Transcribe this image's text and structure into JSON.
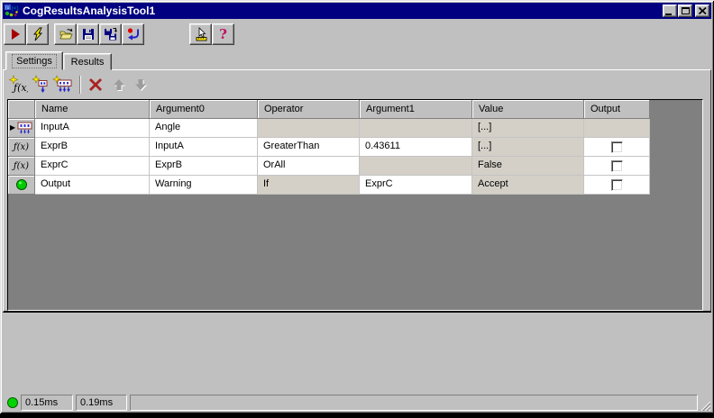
{
  "window": {
    "title": "CogResultsAnalysisTool1"
  },
  "colors": {
    "titlebar": "#000080",
    "window_face": "#c0c0c0",
    "grid_background": "#808080",
    "readonly_cell": "#d4d0c8",
    "led_green": "#00d400",
    "run_red": "#a40000"
  },
  "icons": {
    "titlebar_icon": "app-icon",
    "toolbar": [
      "run-icon",
      "lightning-icon",
      "open-folder-icon",
      "save-icon",
      "save-as-icon",
      "reset-icon",
      "pointer-ruler-icon",
      "help-icon"
    ],
    "grid_toolbar": [
      "add-expression-icon",
      "add-input-icon",
      "add-inputs-icon",
      "delete-icon",
      "move-up-icon",
      "move-down-icon"
    ],
    "caption_buttons": [
      "minimize-icon",
      "maximize-icon",
      "close-icon"
    ]
  },
  "glyphs": {
    "fx": "ƒ(x)",
    "help": "?",
    "current_row": "▶"
  },
  "tabs": {
    "items": [
      {
        "label": "Settings",
        "active": true
      },
      {
        "label": "Results",
        "active": false
      }
    ]
  },
  "grid": {
    "columns": [
      "",
      "Name",
      "Argument0",
      "Operator",
      "Argument1",
      "Value",
      "Output"
    ],
    "rows": [
      {
        "icon": "input-terminal-icon",
        "current": true,
        "name": "InputA",
        "argument0": "Angle",
        "operator": "",
        "argument1": "",
        "value": "[...]",
        "has_checkbox": false,
        "checked": false
      },
      {
        "icon": "function-icon",
        "current": false,
        "name": "ExprB",
        "argument0": "InputA",
        "operator": "GreaterThan",
        "argument1": "0.43611",
        "value": "[...]",
        "has_checkbox": true,
        "checked": false
      },
      {
        "icon": "function-icon",
        "current": false,
        "name": "ExprC",
        "argument0": "ExprB",
        "operator": "OrAll",
        "argument1": "",
        "value": "False",
        "has_checkbox": true,
        "checked": false
      },
      {
        "icon": "output-led-icon",
        "current": false,
        "name": "Output",
        "argument0": "Warning",
        "operator": "If",
        "argument1": "ExprC",
        "value": "Accept",
        "has_checkbox": true,
        "checked": false
      }
    ]
  },
  "statusbar": {
    "panels": [
      "0.15ms",
      "0.19ms",
      ""
    ]
  }
}
